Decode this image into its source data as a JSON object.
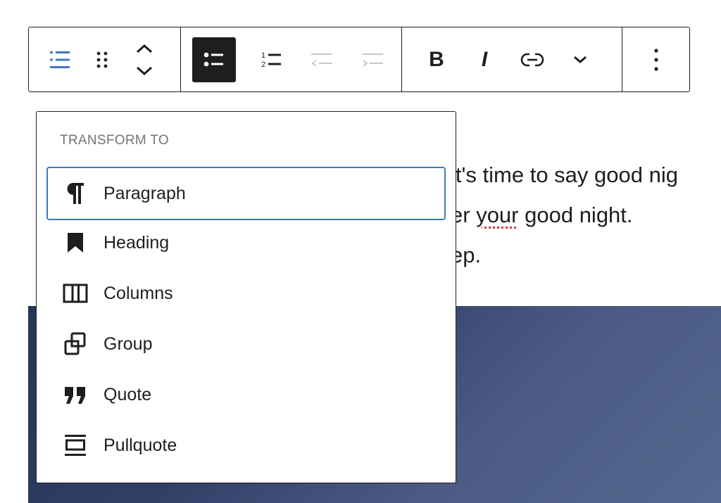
{
  "toolbar": {
    "groups": [
      {
        "buttons": [
          {
            "icon": "list-block-icon",
            "accent": "#3a7cc0"
          },
          {
            "icon": "drag-handle-icon"
          },
          {
            "icon": "move-up-down-icon"
          }
        ]
      },
      {
        "buttons": [
          {
            "icon": "unordered-list-icon",
            "active": true
          },
          {
            "icon": "ordered-list-icon"
          },
          {
            "icon": "outdent-icon",
            "disabled": true
          },
          {
            "icon": "indent-icon",
            "disabled": true
          }
        ]
      },
      {
        "buttons": [
          {
            "icon": "bold-icon",
            "text": "B"
          },
          {
            "icon": "italic-icon",
            "text": "I"
          },
          {
            "icon": "link-icon"
          },
          {
            "icon": "chevron-down-icon"
          }
        ]
      },
      {
        "buttons": [
          {
            "icon": "more-options-icon"
          }
        ]
      }
    ]
  },
  "editor": {
    "line1": "it's time to say good nig",
    "line2_pre": "er ",
    "line2_misspelled": "your",
    "line2_post": " good night.",
    "line3": "ep."
  },
  "popover": {
    "title": "TRANSFORM TO",
    "items": [
      {
        "label": "Paragraph",
        "icon": "paragraph-icon",
        "focused": true
      },
      {
        "label": "Heading",
        "icon": "heading-bookmark-icon"
      },
      {
        "label": "Columns",
        "icon": "columns-icon"
      },
      {
        "label": "Group",
        "icon": "group-icon"
      },
      {
        "label": "Quote",
        "icon": "quote-icon"
      },
      {
        "label": "Pullquote",
        "icon": "pullquote-icon"
      }
    ]
  },
  "colors": {
    "accent": "#3a7cc0",
    "text": "#1e1e1e",
    "muted": "#757575",
    "disabled": "#c8c8c8",
    "cover_dark": "#253457",
    "cover_light": "#56688f",
    "spellcheck": "#d63638"
  }
}
